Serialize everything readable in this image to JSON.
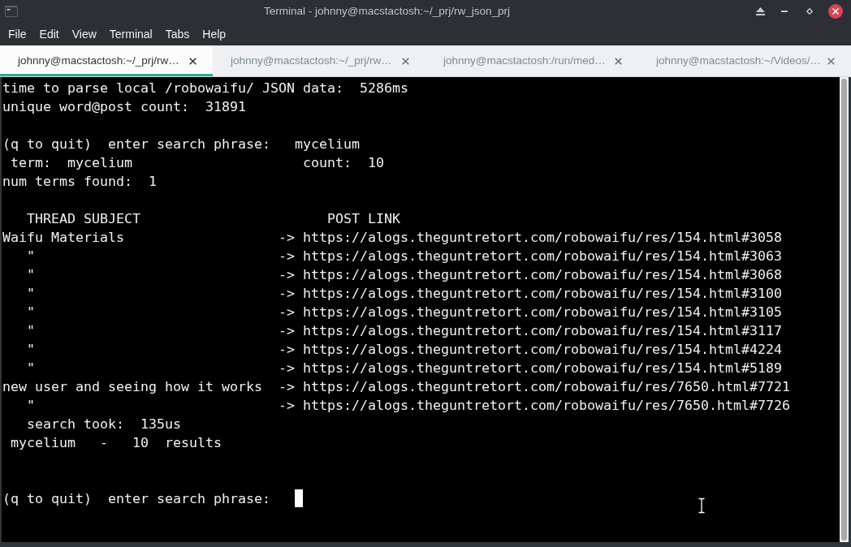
{
  "window": {
    "title": "Terminal - johnny@macstactosh:~/_prj/rw_json_prj"
  },
  "menu": [
    "File",
    "Edit",
    "View",
    "Terminal",
    "Tabs",
    "Help"
  ],
  "tabs": [
    {
      "label": "johnny@macstactosh:~/_prj/rw…",
      "selected": true
    },
    {
      "label": "johnny@macstactosh:~/_prj/rw…",
      "selected": false
    },
    {
      "label": "johnny@macstactosh:/run/med…",
      "selected": false
    },
    {
      "label": "johnny@macstactosh:~/Videos/…",
      "selected": false
    }
  ],
  "terminal": {
    "lines": [
      {
        "kind": "text",
        "text": "time to parse local /robowaifu/ JSON data:  5286ms"
      },
      {
        "kind": "text",
        "text": "unique word@post count:  31891"
      },
      {
        "kind": "blank"
      },
      {
        "kind": "text",
        "text": "(q to quit)  enter search phrase:   mycelium"
      },
      {
        "kind": "text",
        "text": " term:  mycelium                     count:  10"
      },
      {
        "kind": "text",
        "text": "num terms found:  1"
      },
      {
        "kind": "blank"
      },
      {
        "kind": "header",
        "columns": [
          "THREAD SUBJECT",
          "POST LINK"
        ]
      },
      {
        "kind": "result",
        "subject": "Waifu Materials",
        "arrow": "->",
        "link": "https://alogs.theguntretort.com/robowaifu/res/154.html#3058"
      },
      {
        "kind": "ditto",
        "subject": "\"",
        "arrow": "->",
        "link": "https://alogs.theguntretort.com/robowaifu/res/154.html#3063"
      },
      {
        "kind": "ditto",
        "subject": "\"",
        "arrow": "->",
        "link": "https://alogs.theguntretort.com/robowaifu/res/154.html#3068"
      },
      {
        "kind": "ditto",
        "subject": "\"",
        "arrow": "->",
        "link": "https://alogs.theguntretort.com/robowaifu/res/154.html#3100"
      },
      {
        "kind": "ditto",
        "subject": "\"",
        "arrow": "->",
        "link": "https://alogs.theguntretort.com/robowaifu/res/154.html#3105"
      },
      {
        "kind": "ditto",
        "subject": "\"",
        "arrow": "->",
        "link": "https://alogs.theguntretort.com/robowaifu/res/154.html#3117"
      },
      {
        "kind": "ditto",
        "subject": "\"",
        "arrow": "->",
        "link": "https://alogs.theguntretort.com/robowaifu/res/154.html#4224"
      },
      {
        "kind": "ditto",
        "subject": "\"",
        "arrow": "->",
        "link": "https://alogs.theguntretort.com/robowaifu/res/154.html#5189"
      },
      {
        "kind": "result",
        "subject": "new user and seeing how it works",
        "arrow": "->",
        "link": "https://alogs.theguntretort.com/robowaifu/res/7650.html#7721"
      },
      {
        "kind": "ditto",
        "subject": "\"",
        "arrow": "->",
        "link": "https://alogs.theguntretort.com/robowaifu/res/7650.html#7726"
      },
      {
        "kind": "text",
        "text": "   search took:  135us"
      },
      {
        "kind": "text",
        "text": " mycelium   -   10  results"
      },
      {
        "kind": "blank"
      },
      {
        "kind": "blank"
      },
      {
        "kind": "prompt",
        "text": "(q to quit)  enter search phrase:",
        "cursor": true
      }
    ]
  }
}
